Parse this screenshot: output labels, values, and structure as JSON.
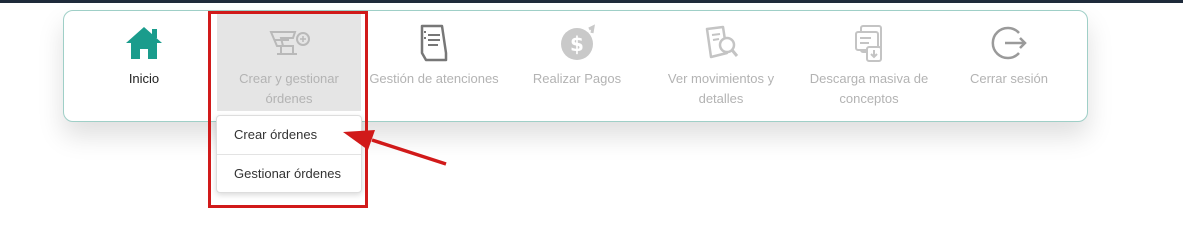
{
  "nav": {
    "items": [
      {
        "label": "Inicio",
        "icon": "home-icon",
        "color": "#1a9c8c"
      },
      {
        "label": "Crear y gestionar órdenes",
        "icon": "create-orders-icon"
      },
      {
        "label": "Gestión de atenciones",
        "icon": "document-icon"
      },
      {
        "label": "Realizar Pagos",
        "icon": "payment-icon"
      },
      {
        "label": "Ver movimientos y detalles",
        "icon": "movements-icon"
      },
      {
        "label": "Descarga masiva de conceptos",
        "icon": "bulk-download-icon"
      },
      {
        "label": "Cerrar sesión",
        "icon": "logout-icon"
      }
    ]
  },
  "dropdown": {
    "items": [
      {
        "label": "Crear órdenes"
      },
      {
        "label": "Gestionar órdenes"
      }
    ]
  },
  "annotation": {
    "color": "#d11a1a"
  }
}
